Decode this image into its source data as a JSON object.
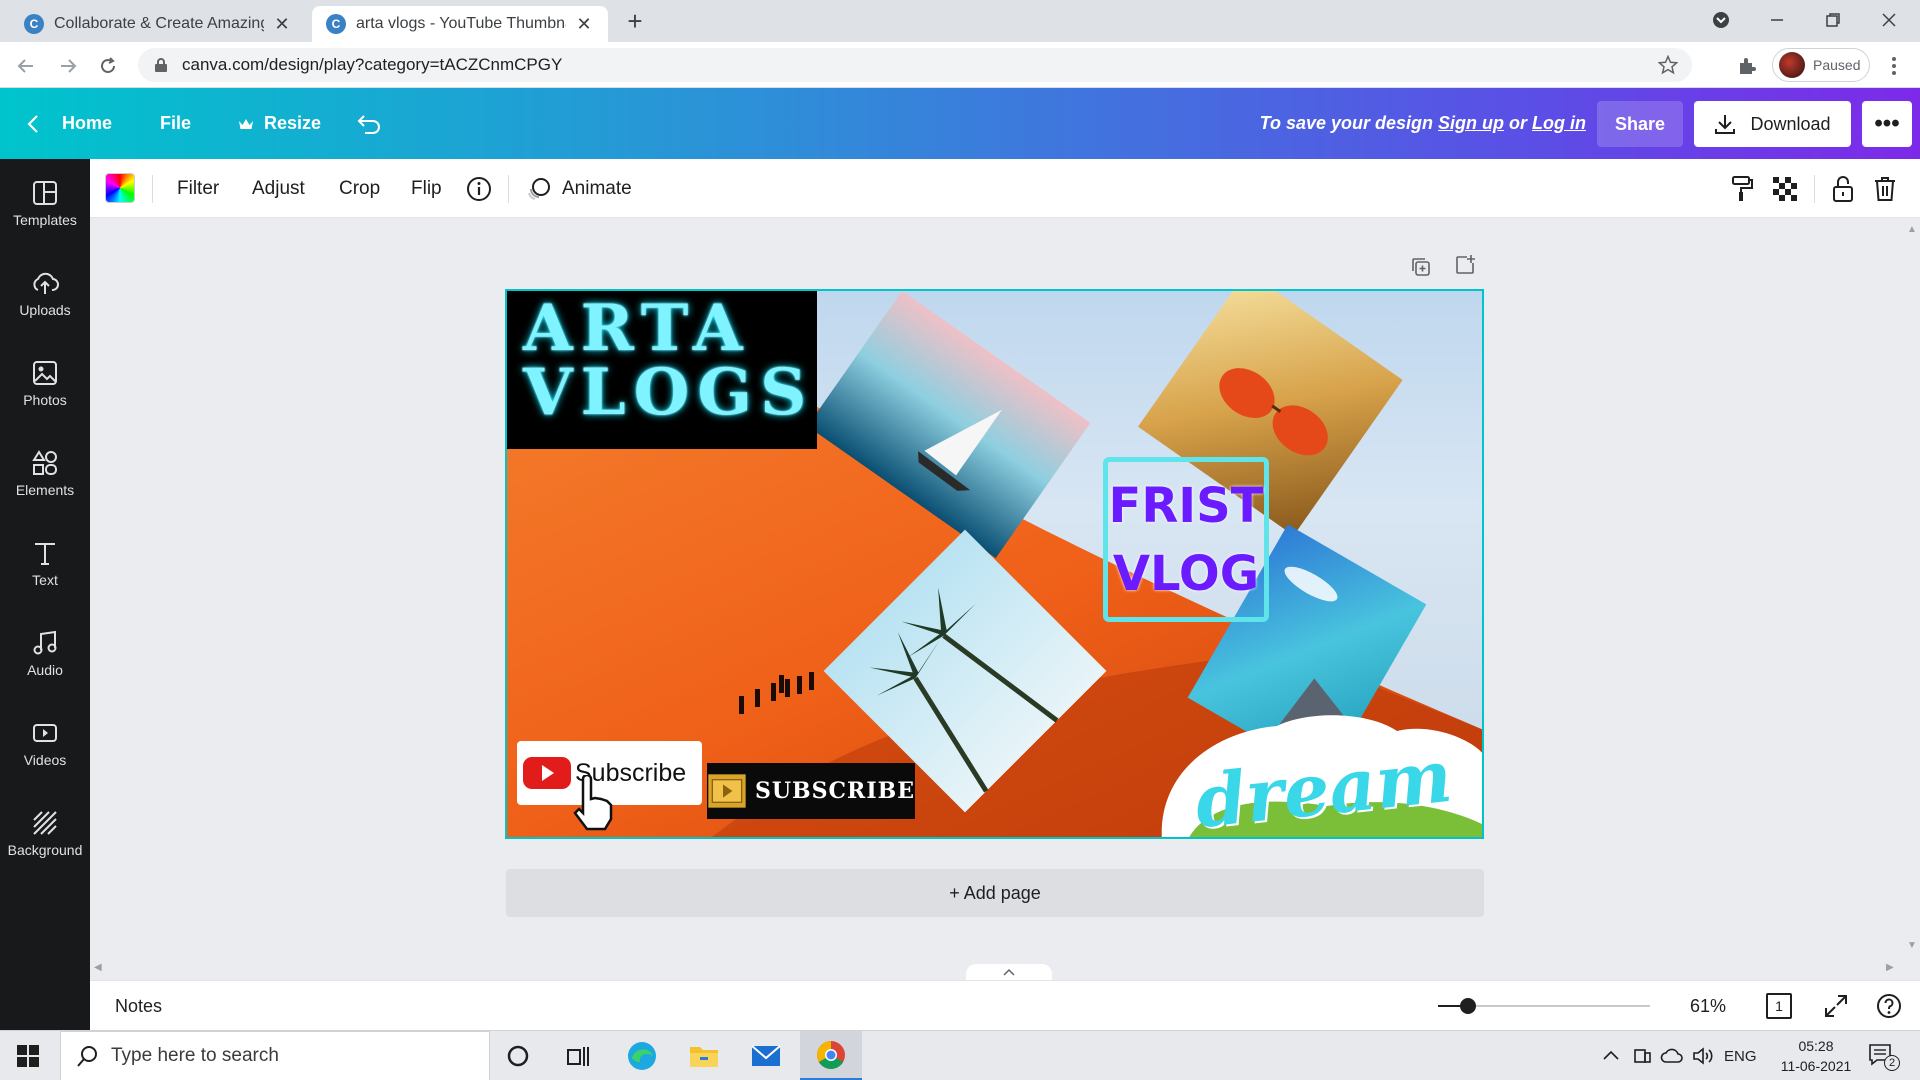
{
  "browser": {
    "tabs": [
      {
        "title": "Collaborate & Create Amazing G",
        "active": false
      },
      {
        "title": "arta vlogs - YouTube Thumbnail",
        "active": true
      }
    ],
    "url": "canva.com/design/play?category=tACZCnmCPGY",
    "profile_status": "Paused"
  },
  "header": {
    "home_label": "Home",
    "file_label": "File",
    "resize_label": "Resize",
    "save_prefix": "To save your design",
    "signup_label": "Sign up",
    "or_label": "or",
    "login_label": "Log in",
    "share_label": "Share",
    "download_label": "Download",
    "more_label": "•••"
  },
  "sidebar": {
    "items": [
      {
        "label": "Templates",
        "icon": "templates-icon"
      },
      {
        "label": "Uploads",
        "icon": "uploads-icon"
      },
      {
        "label": "Photos",
        "icon": "photos-icon"
      },
      {
        "label": "Elements",
        "icon": "elements-icon"
      },
      {
        "label": "Text",
        "icon": "text-icon"
      },
      {
        "label": "Audio",
        "icon": "audio-icon"
      },
      {
        "label": "Videos",
        "icon": "videos-icon"
      },
      {
        "label": "Background",
        "icon": "background-icon"
      }
    ]
  },
  "toolbar": {
    "filter_label": "Filter",
    "adjust_label": "Adjust",
    "crop_label": "Crop",
    "flip_label": "Flip",
    "animate_label": "Animate"
  },
  "design": {
    "title_line1": "ARTA",
    "title_line2": "VLOGS",
    "frame_line1": "FRIST",
    "frame_line2": "VLOG",
    "subscribe_red": "Subscribe",
    "subscribe_gold": "SUBSCRIBE",
    "dream_text": "dream",
    "colors": {
      "accent": "#00c4cc",
      "title_glow": "#7ff3ff",
      "frame_text": "#6a1bff",
      "sand": "#f26a1e"
    }
  },
  "canvas": {
    "add_page_label": "+ Add page"
  },
  "footer": {
    "notes_label": "Notes",
    "zoom": "61%",
    "page_count": "1",
    "zoom_fraction": 0.1
  },
  "taskbar": {
    "search_placeholder": "Type here to search",
    "language": "ENG",
    "time": "05:28",
    "date": "11-06-2021",
    "notification_count": "2"
  }
}
